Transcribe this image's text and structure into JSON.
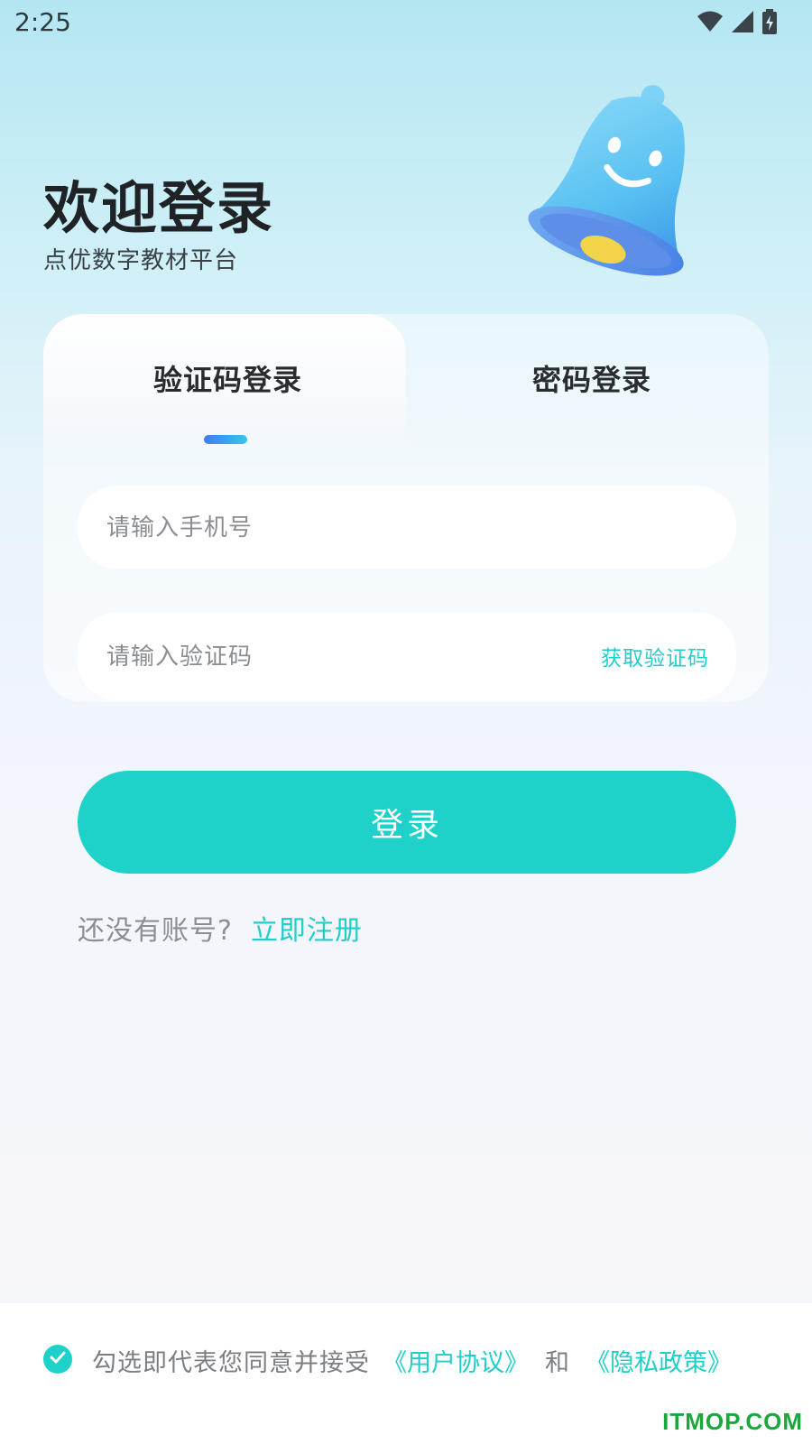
{
  "status_bar": {
    "time": "2:25",
    "icons": [
      "wifi-icon",
      "signal-icon",
      "battery-charging-icon"
    ]
  },
  "header": {
    "title": "欢迎登录",
    "subtitle": "点优数字教材平台",
    "illustration": "bell-icon"
  },
  "tabs": [
    {
      "label": "验证码登录",
      "active": true
    },
    {
      "label": "密码登录",
      "active": false
    }
  ],
  "form": {
    "phone_placeholder": "请输入手机号",
    "phone_value": "",
    "code_placeholder": "请输入验证码",
    "code_value": "",
    "get_code_label": "获取验证码"
  },
  "login_button": {
    "label": "登录"
  },
  "register": {
    "prompt": "还没有账号?",
    "link": "立即注册"
  },
  "agreement": {
    "checked": true,
    "text": "勾选即代表您同意并接受",
    "user_agreement": "《用户协议》",
    "and": "和",
    "privacy_policy": "《隐私政策》"
  },
  "watermark": "ITMOP.COM",
  "colors": {
    "accent": "#1fd2c9",
    "link": "#1fcfc8",
    "title": "#1f2326",
    "tab_indicator_start": "#3f7cf0",
    "tab_indicator_end": "#35c7ee",
    "watermark": "#1aa83c"
  }
}
